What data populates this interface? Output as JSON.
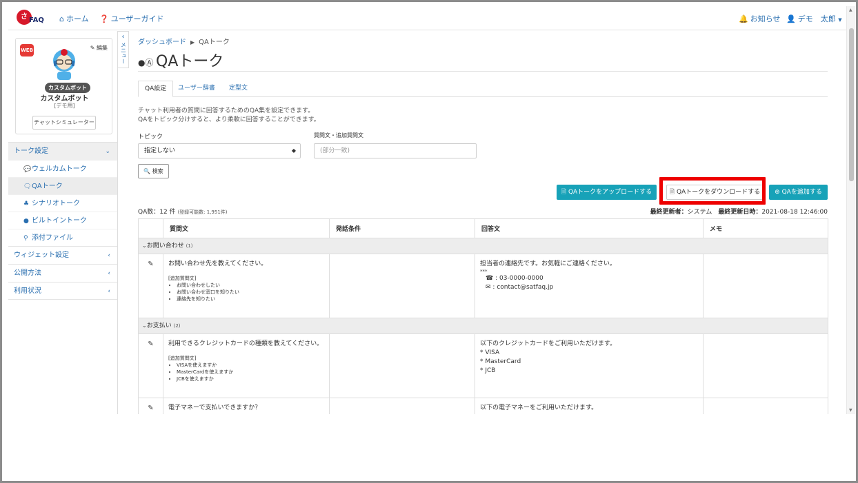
{
  "app": {
    "logo_text": "FAQ",
    "logo_mark": "さ"
  },
  "topnav": {
    "home": "ホーム",
    "guide": "ユーザーガイド",
    "notifications": "お知らせ",
    "user": "デモ　太郎"
  },
  "profile": {
    "web_badge": "WEB",
    "edit": "編集",
    "bot_badge": "カスタムボット",
    "bot_name": "カスタムボット",
    "bot_sub": "[デモ用]",
    "simulator": "チャットシミュレーター"
  },
  "menu": {
    "talk_settings": "トーク設定",
    "items": [
      {
        "label": "ウェルカムトーク",
        "icon": "welcome-icon"
      },
      {
        "label": "QAトーク",
        "icon": "qa-icon"
      },
      {
        "label": "シナリオトーク",
        "icon": "sitemap-icon"
      },
      {
        "label": "ビルトイントーク",
        "icon": "comments-icon"
      },
      {
        "label": "添付ファイル",
        "icon": "paperclip-icon"
      }
    ],
    "widget": "ウィジェット設定",
    "publish": "公開方法",
    "usage": "利用状況",
    "toggle": "メニュー"
  },
  "breadcrumb": {
    "root": "ダッシュボード",
    "current": "QAトーク"
  },
  "page": {
    "title": "QAトーク"
  },
  "tabs": [
    "QA設定",
    "ユーザー辞書",
    "定型文"
  ],
  "description": [
    "チャット利用者の質問に回答するためのQA集を設定できます。",
    "QAをトピック分けすると、より柔軟に回答することができます。"
  ],
  "filters": {
    "topic_label": "トピック",
    "topic_value": "指定しない",
    "question_label": "質問文・追加質問文",
    "question_placeholder": "(部分一致)",
    "search": "検索"
  },
  "actions": {
    "upload": "QAトークをアップロードする",
    "download": "QAトークをダウンロードする",
    "add": "QAを追加する"
  },
  "stats": {
    "count": "QA数：12 件",
    "limit": "(登録可能数: 1,951件)",
    "updated_by_label": "最終更新者：",
    "updated_by": "システム",
    "updated_at_label": "最終更新日時：",
    "updated_at": "2021-08-18 12:46:00"
  },
  "table": {
    "headers": [
      "",
      "質問文",
      "発話条件",
      "回答文",
      "メモ"
    ],
    "groups": [
      {
        "name": "お問い合わせ",
        "count": "(1)"
      },
      {
        "name": "お支払い",
        "count": "(2)"
      }
    ],
    "rows": [
      {
        "question": "お問い合わせ先を教えてください。",
        "additional_label": "[追加質問文]",
        "additional": [
          "お問い合わせしたい",
          "お問い合わせ窓口を知りたい",
          "連絡先を知りたい"
        ],
        "answer": [
          "担当者の連絡先です。お気軽にご連絡ください。",
          "***",
          "☎ : 03-0000-0000",
          "✉ : contact@satfaq.jp"
        ],
        "memo": ""
      },
      {
        "question": "利用できるクレジットカードの種類を教えてください。",
        "additional_label": "[追加質問文]",
        "additional": [
          "VISAを使えますか",
          "MasterCardを使えますか",
          "JCBを使えますか"
        ],
        "answer": [
          "以下のクレジットカードをご利用いただけます。",
          "* VISA",
          "* MasterCard",
          "* JCB"
        ],
        "memo": ""
      },
      {
        "question": "電子マネーで支払いできますか？",
        "answer": [
          "以下の電子マネーをご利用いただけます。"
        ],
        "memo": ""
      }
    ]
  }
}
